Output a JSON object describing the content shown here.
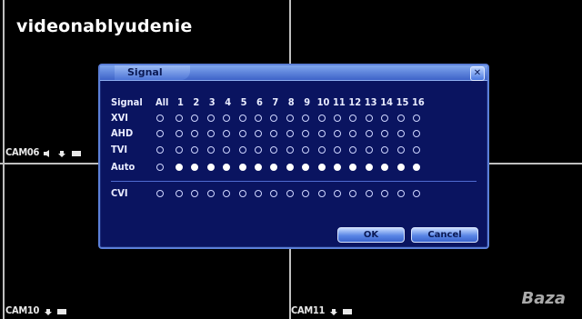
{
  "watermark": "videonablyudenie",
  "logo_text": "Baza",
  "cameras": {
    "cam06": "CAM06",
    "cam10": "CAM10",
    "cam11": "CAM11"
  },
  "dialog": {
    "title": "Signal",
    "header": {
      "signal": "Signal",
      "all": "All",
      "channels": [
        "1",
        "2",
        "3",
        "4",
        "5",
        "6",
        "7",
        "8",
        "9",
        "10",
        "11",
        "12",
        "13",
        "14",
        "15",
        "16"
      ]
    },
    "rows": [
      {
        "label": "XVI",
        "all": false,
        "channels": [
          false,
          false,
          false,
          false,
          false,
          false,
          false,
          false,
          false,
          false,
          false,
          false,
          false,
          false,
          false,
          false
        ]
      },
      {
        "label": "AHD",
        "all": false,
        "channels": [
          false,
          false,
          false,
          false,
          false,
          false,
          false,
          false,
          false,
          false,
          false,
          false,
          false,
          false,
          false,
          false
        ]
      },
      {
        "label": "TVI",
        "all": false,
        "channels": [
          false,
          false,
          false,
          false,
          false,
          false,
          false,
          false,
          false,
          false,
          false,
          false,
          false,
          false,
          false,
          false
        ]
      },
      {
        "label": "Auto",
        "all": false,
        "channels": [
          true,
          true,
          true,
          true,
          true,
          true,
          true,
          true,
          true,
          true,
          true,
          true,
          true,
          true,
          true,
          true
        ]
      }
    ],
    "cvi_row": {
      "label": "CVI",
      "all": false,
      "channels": [
        false,
        false,
        false,
        false,
        false,
        false,
        false,
        false,
        false,
        false,
        false,
        false,
        false,
        false,
        false,
        false
      ]
    },
    "ok_label": "OK",
    "cancel_label": "Cancel"
  },
  "colors": {
    "dialog_bg": "#0a1460",
    "accent": "#5b7fd8"
  }
}
